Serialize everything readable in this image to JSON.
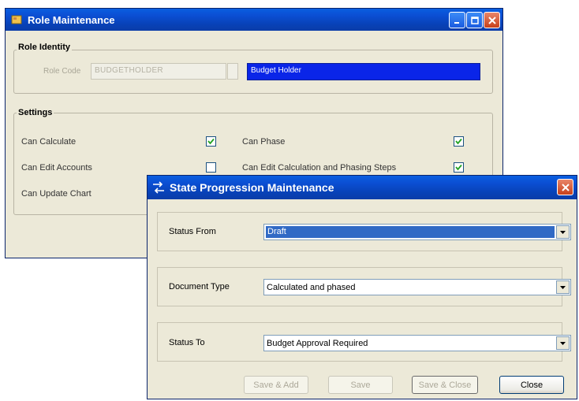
{
  "role_window": {
    "title": "Role Maintenance",
    "identity_group": "Role Identity",
    "role_code_label": "Role Code",
    "role_code_value": "BUDGETHOLDER",
    "role_name_value": "Budget Holder",
    "settings_group": "Settings",
    "settings": [
      {
        "label": "Can Calculate",
        "checked": true
      },
      {
        "label": "Can Phase",
        "checked": true
      },
      {
        "label": "Can Edit Accounts",
        "checked": false
      },
      {
        "label": "Can Edit Calculation and Phasing Steps",
        "checked": true
      },
      {
        "label": "Can Update Chart",
        "checked": false
      }
    ]
  },
  "state_window": {
    "title": "State Progression Maintenance",
    "status_from_label": "Status From",
    "status_from_value": "Draft",
    "document_type_label": "Document Type",
    "document_type_value": "Calculated and phased",
    "status_to_label": "Status To",
    "status_to_value": "Budget Approval Required",
    "buttons": {
      "save_add": "Save & Add",
      "save": "Save",
      "save_close": "Save & Close",
      "close": "Close"
    }
  },
  "colors": {
    "title_bar": "#0a4fd4",
    "selection": "#316ac5",
    "highlight_field": "#0a25e8",
    "window_bg": "#ece9d8",
    "close_button": "#c8401a"
  }
}
